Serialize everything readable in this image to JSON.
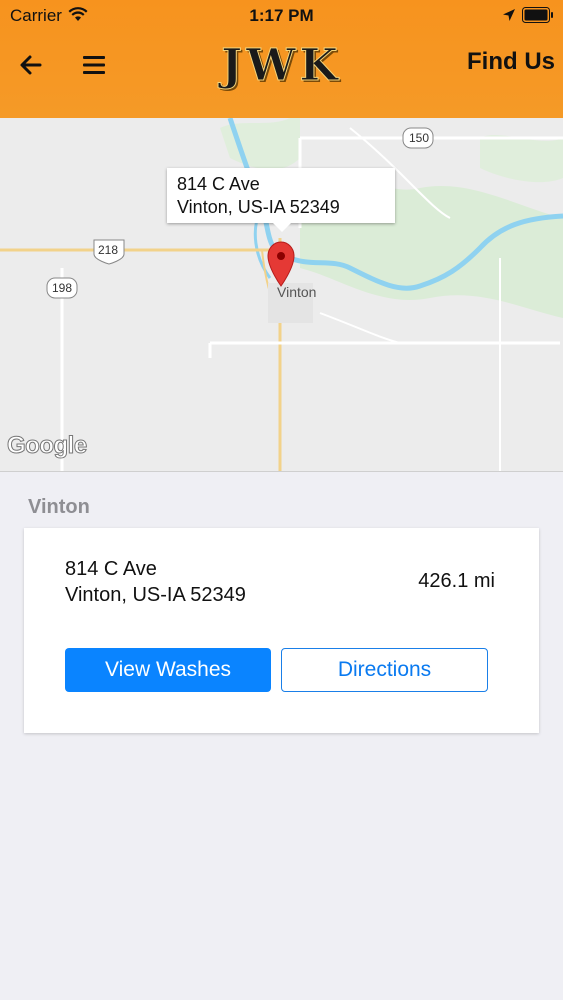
{
  "status_bar": {
    "carrier": "Carrier",
    "time": "1:17 PM"
  },
  "nav": {
    "back_icon": "arrow-left-icon",
    "menu_icon": "hamburger-menu-icon",
    "logo": "JWK",
    "title": "Find Us",
    "background": "#f7931e"
  },
  "map": {
    "callout": {
      "line1": "814 C Ave",
      "line2": "Vinton, US-IA  52349"
    },
    "city_label": "Vinton",
    "route_shields": [
      "150",
      "218",
      "198"
    ],
    "attribution": "Google",
    "pin_color": "#e53935"
  },
  "location": {
    "section_title": "Vinton",
    "address_line1": "814 C Ave",
    "address_line2": "Vinton, US-IA  52349",
    "distance": "426.1 mi",
    "view_washes_label": "View Washes",
    "directions_label": "Directions",
    "accent_color": "#0a84ff"
  }
}
